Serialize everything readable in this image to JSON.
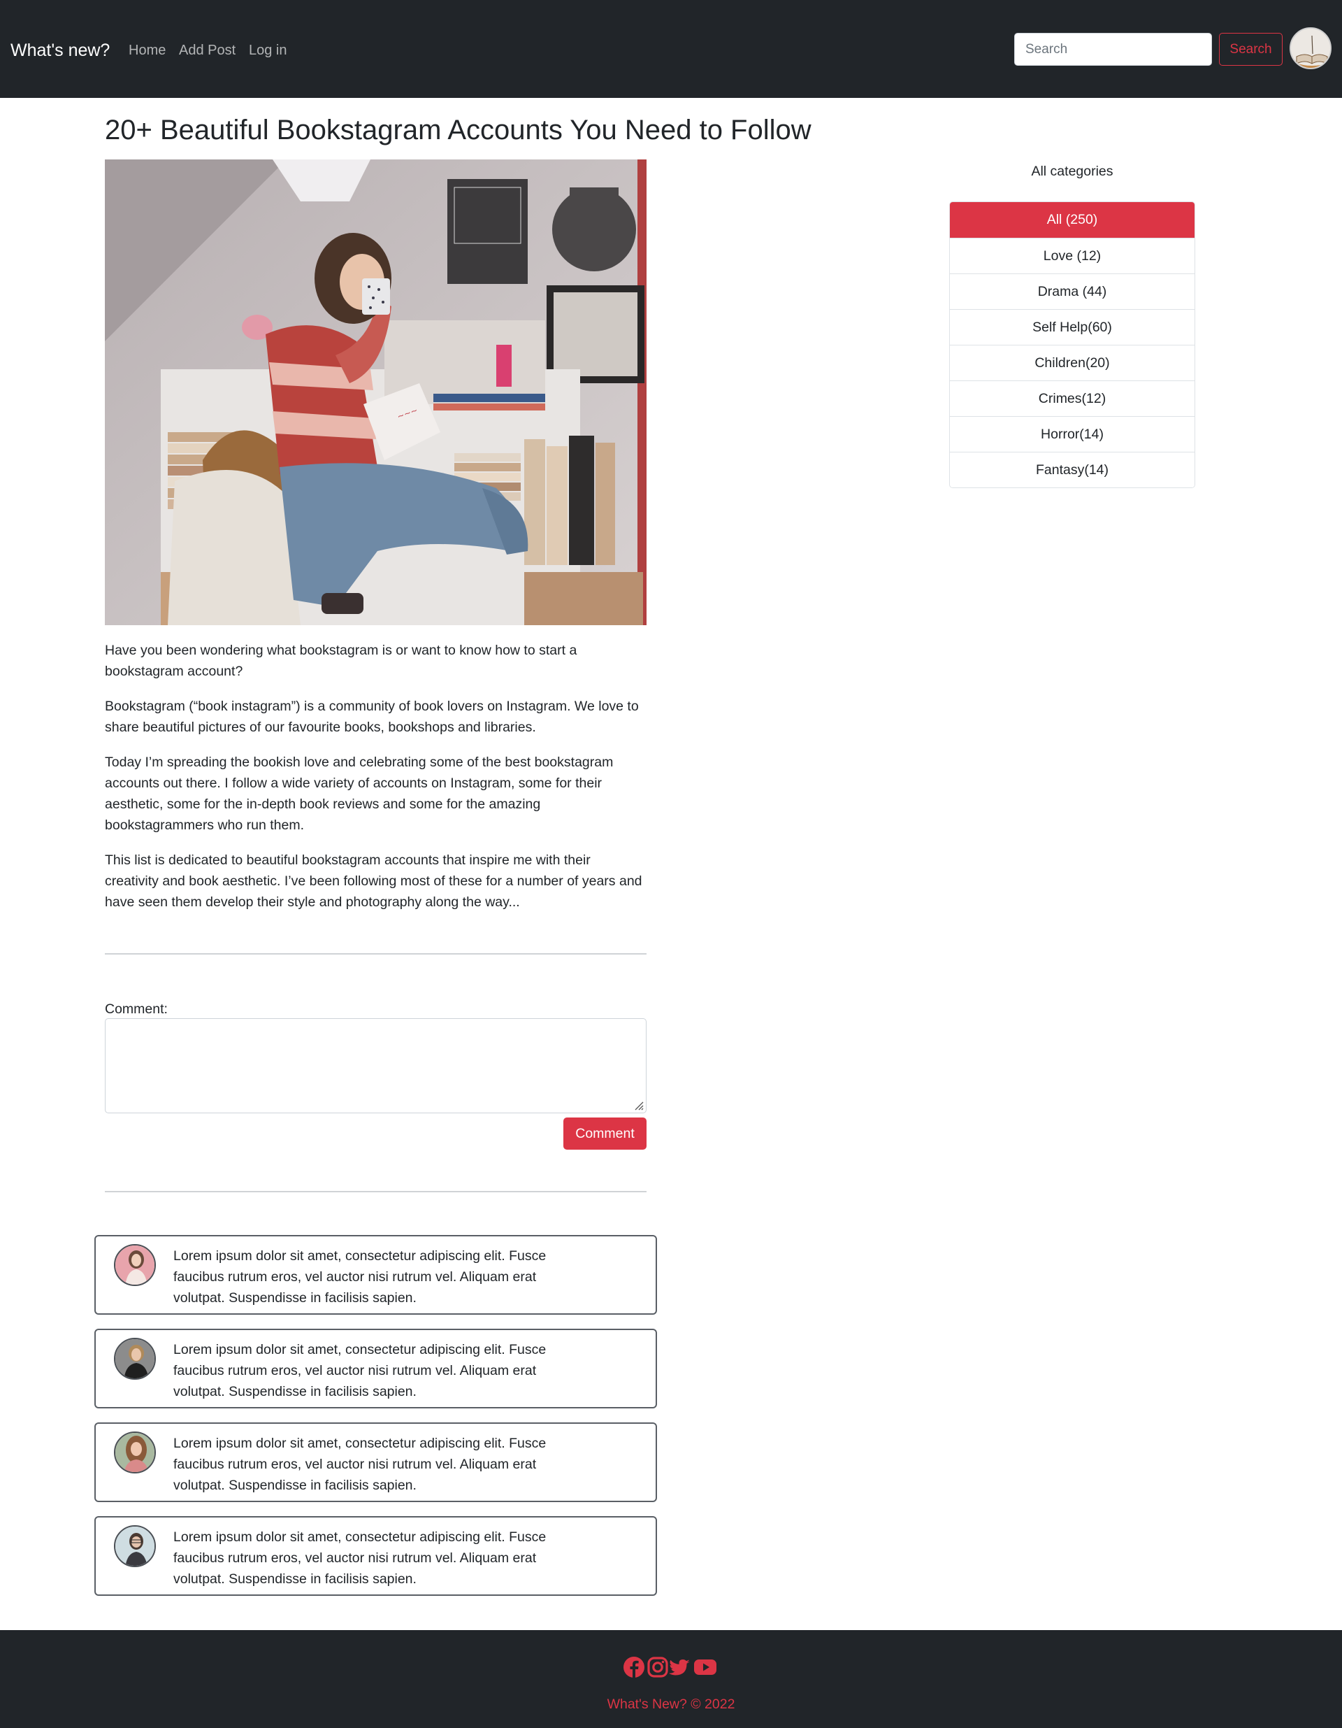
{
  "navbar": {
    "brand": "What's new?",
    "links": [
      "Home",
      "Add Post",
      "Log in"
    ],
    "search_placeholder": "Search",
    "search_button": "Search",
    "avatar_icon": "book-avatar-icon"
  },
  "post": {
    "title": "20+ Beautiful Bookstagram Accounts You Need to Follow",
    "paragraphs": [
      "Have you been wondering what bookstagram is or want to know how to start a bookstagram account?",
      "Bookstagram (“book instagram”) is a community of book lovers on Instagram. We love to share beautiful pictures of our favourite books, bookshops and libraries.",
      "Today I’m spreading the bookish love and celebrating some of the best bookstagram accounts out there. I follow a wide variety of accounts on Instagram, some for their aesthetic, some for the in-depth book reviews and some for the amazing bookstagrammers who run them.",
      "This list is dedicated to beautiful bookstagram accounts that inspire me with their creativity and book aesthetic. I’ve been following most of these for a number of years and have seen them develop their style and photography along the way..."
    ]
  },
  "comment_form": {
    "label": "Comment:",
    "value": "",
    "button": "Comment"
  },
  "comments": [
    {
      "text": "Lorem ipsum dolor sit amet, consectetur adipiscing elit. Fusce faucibus rutrum eros, vel auctor nisi rutrum vel. Aliquam erat volutpat. Suspendisse in facilisis sapien."
    },
    {
      "text": "Lorem ipsum dolor sit amet, consectetur adipiscing elit. Fusce faucibus rutrum eros, vel auctor nisi rutrum vel. Aliquam erat volutpat. Suspendisse in facilisis sapien."
    },
    {
      "text": "Lorem ipsum dolor sit amet, consectetur adipiscing elit. Fusce faucibus rutrum eros, vel auctor nisi rutrum vel. Aliquam erat volutpat. Suspendisse in facilisis sapien."
    },
    {
      "text": "Lorem ipsum dolor sit amet, consectetur adipiscing elit. Fusce faucibus rutrum eros, vel auctor nisi rutrum vel. Aliquam erat volutpat. Suspendisse in facilisis sapien."
    }
  ],
  "sidebar": {
    "heading": "All categories",
    "categories": [
      {
        "label": "All (250)",
        "active": true
      },
      {
        "label": "Love (12)",
        "active": false
      },
      {
        "label": "Drama (44)",
        "active": false
      },
      {
        "label": "Self Help(60)",
        "active": false
      },
      {
        "label": "Children(20)",
        "active": false
      },
      {
        "label": "Crimes(12)",
        "active": false
      },
      {
        "label": "Horror(14)",
        "active": false
      },
      {
        "label": "Fantasy(14)",
        "active": false
      }
    ]
  },
  "footer": {
    "icons": [
      "facebook-icon",
      "instagram-icon",
      "twitter-icon",
      "youtube-icon"
    ],
    "copyright": "What's New? © 2022"
  },
  "colors": {
    "accent": "#dc3545",
    "dark": "#212529"
  }
}
